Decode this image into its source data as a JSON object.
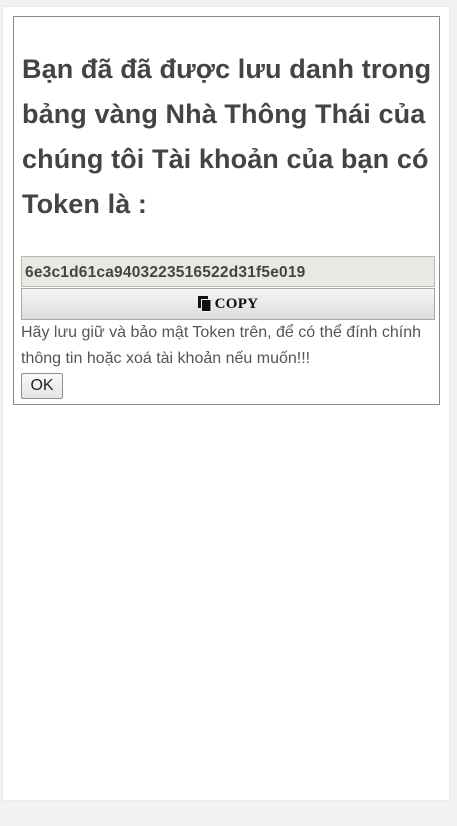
{
  "dialog": {
    "title": "Bạn đã đã được lưu danh trong bảng vàng Nhà Thông Thái của chúng tôi Tài khoản của bạn có Token là :",
    "token": "6e3c1d61ca9403223516522d31f5e019",
    "copy_button": {
      "label": "COPY",
      "icon": "copy-icon"
    },
    "note": "Hãy lưu giữ và bảo mật Token trên, để có thể đính chính thông tin hoặc xoá tài khoản nếu muốn!!!",
    "ok_button": {
      "label": "OK"
    }
  },
  "colors": {
    "text": "#444444",
    "token_background": "#e9e9e4",
    "border": "#8a8a8a"
  }
}
